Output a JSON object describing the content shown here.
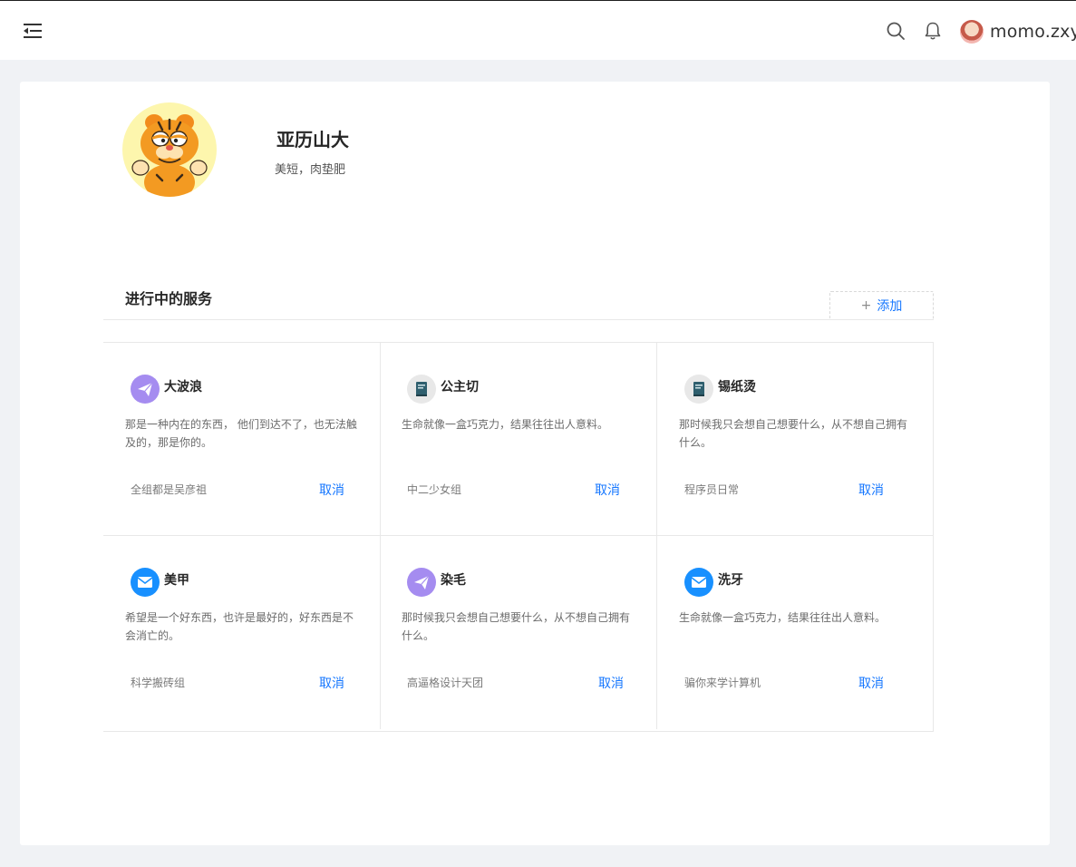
{
  "header": {
    "user_name": "momo.zxy",
    "icons": [
      "menu-fold-icon",
      "search-icon",
      "bell-icon"
    ]
  },
  "profile": {
    "name": "亚历山大",
    "bio": "美短，肉垫肥"
  },
  "section": {
    "title": "进行中的服务",
    "add_label": "添加"
  },
  "services": [
    {
      "icon": "paper-plane-icon",
      "title": "大波浪",
      "desc": "那是一种内在的东西， 他们到达不了，也无法触及的，那是你的。",
      "team": "全组都是吴彦祖",
      "action": "取消"
    },
    {
      "icon": "book-icon",
      "title": "公主切",
      "desc": "生命就像一盒巧克力，结果往往出人意料。",
      "team": "中二少女组",
      "action": "取消"
    },
    {
      "icon": "book-icon",
      "title": "锡纸烫",
      "desc": "那时候我只会想自己想要什么，从不想自己拥有什么。",
      "team": "程序员日常",
      "action": "取消"
    },
    {
      "icon": "mail-icon",
      "title": "美甲",
      "desc": "希望是一个好东西，也许是最好的，好东西是不会消亡的。",
      "team": "科学搬砖组",
      "action": "取消"
    },
    {
      "icon": "paper-plane-icon",
      "title": "染毛",
      "desc": "那时候我只会想自己想要什么，从不想自己拥有什么。",
      "team": "高逼格设计天团",
      "action": "取消"
    },
    {
      "icon": "mail-icon",
      "title": "洗牙",
      "desc": "生命就像一盒巧克力，结果往往出人意料。",
      "team": "骗你来学计算机",
      "action": "取消"
    }
  ],
  "colors": {
    "accent": "#1677ff",
    "page_bg": "#f0f2f5",
    "plane_icon": "#a58cf0",
    "mail_icon": "#1890ff",
    "book_icon_bg": "#e8e8e8"
  }
}
